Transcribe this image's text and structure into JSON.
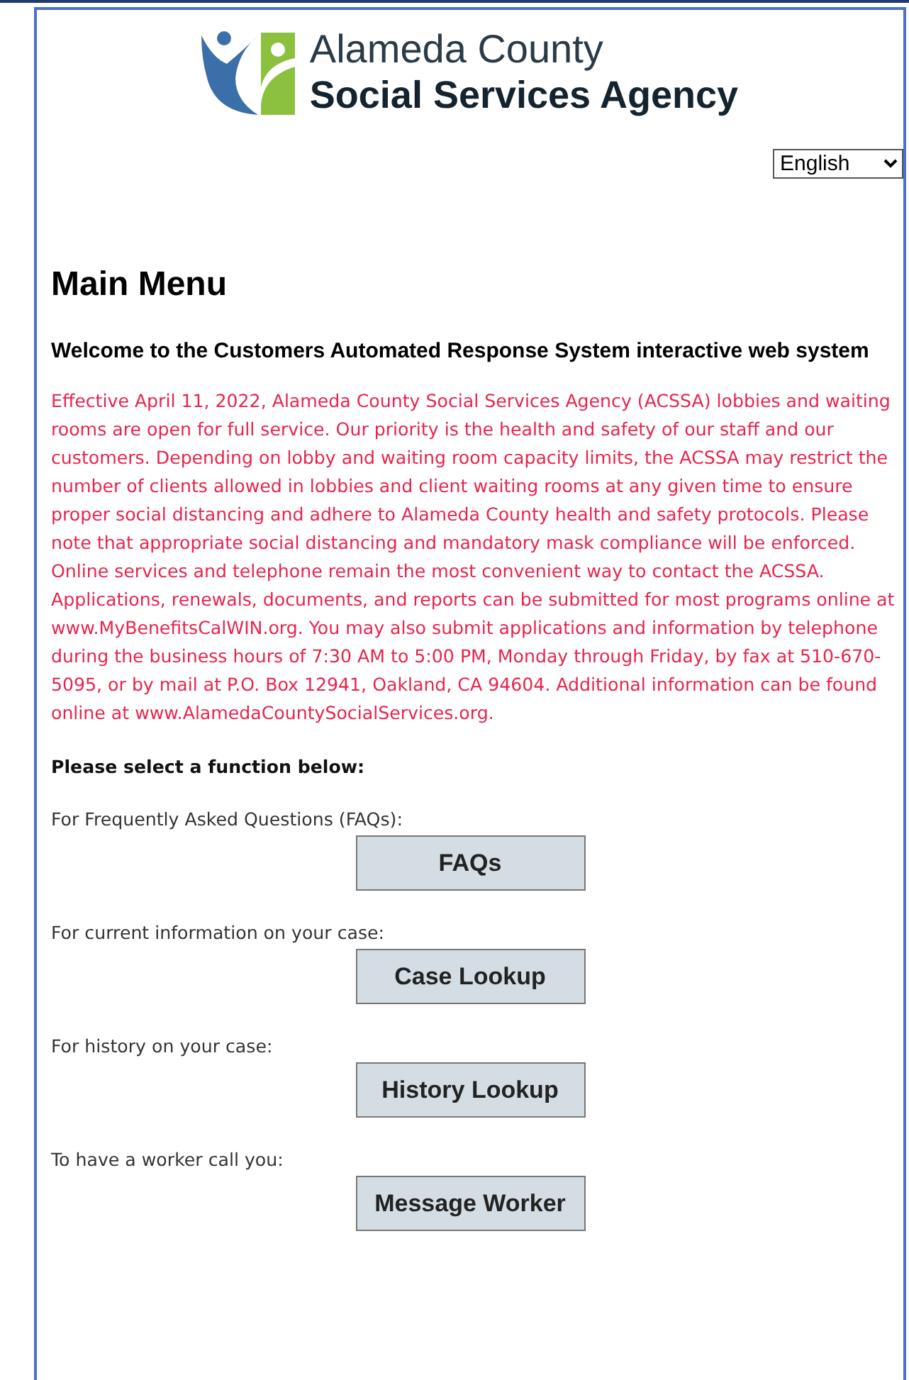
{
  "header": {
    "logo_line_1": "Alameda County",
    "logo_line_2": "Social Services Agency",
    "language": "English"
  },
  "title": "Main Menu",
  "welcome": "Welcome to the Customers Automated Response System interactive web system",
  "notice": "Effective April 11, 2022, Alameda County Social Services Agency (ACSSA) lobbies and waiting rooms are open for full service. Our priority is the health and safety of our staff and our customers. Depending on lobby and waiting room capacity limits, the ACSSA may restrict the number of clients allowed in lobbies and client waiting rooms at any given time to ensure proper social distancing and adhere to Alameda County health and safety protocols. Please note that appropriate social distancing and mandatory mask compliance will be enforced. Online services and telephone remain the most convenient way to contact the ACSSA. Applications, renewals, documents, and reports can be submitted for most programs online at www.MyBenefitsCalWIN.org. You may also submit applications and information by telephone during the business hours of 7:30 AM to 5:00 PM, Monday through Friday, by fax at 510-670-5095, or by mail at P.O. Box 12941, Oakland, CA 94604. Additional information can be found online at www.AlamedaCountySocialServices.org.",
  "prompt": "Please select a function below:",
  "functions": [
    {
      "label": "For Frequently Asked Questions (FAQs):",
      "button": "FAQs"
    },
    {
      "label": "For current information on your case:",
      "button": "Case Lookup"
    },
    {
      "label": "For history on your case:",
      "button": "History Lookup"
    },
    {
      "label": "To have a worker call you:",
      "button": "Message Worker"
    }
  ]
}
